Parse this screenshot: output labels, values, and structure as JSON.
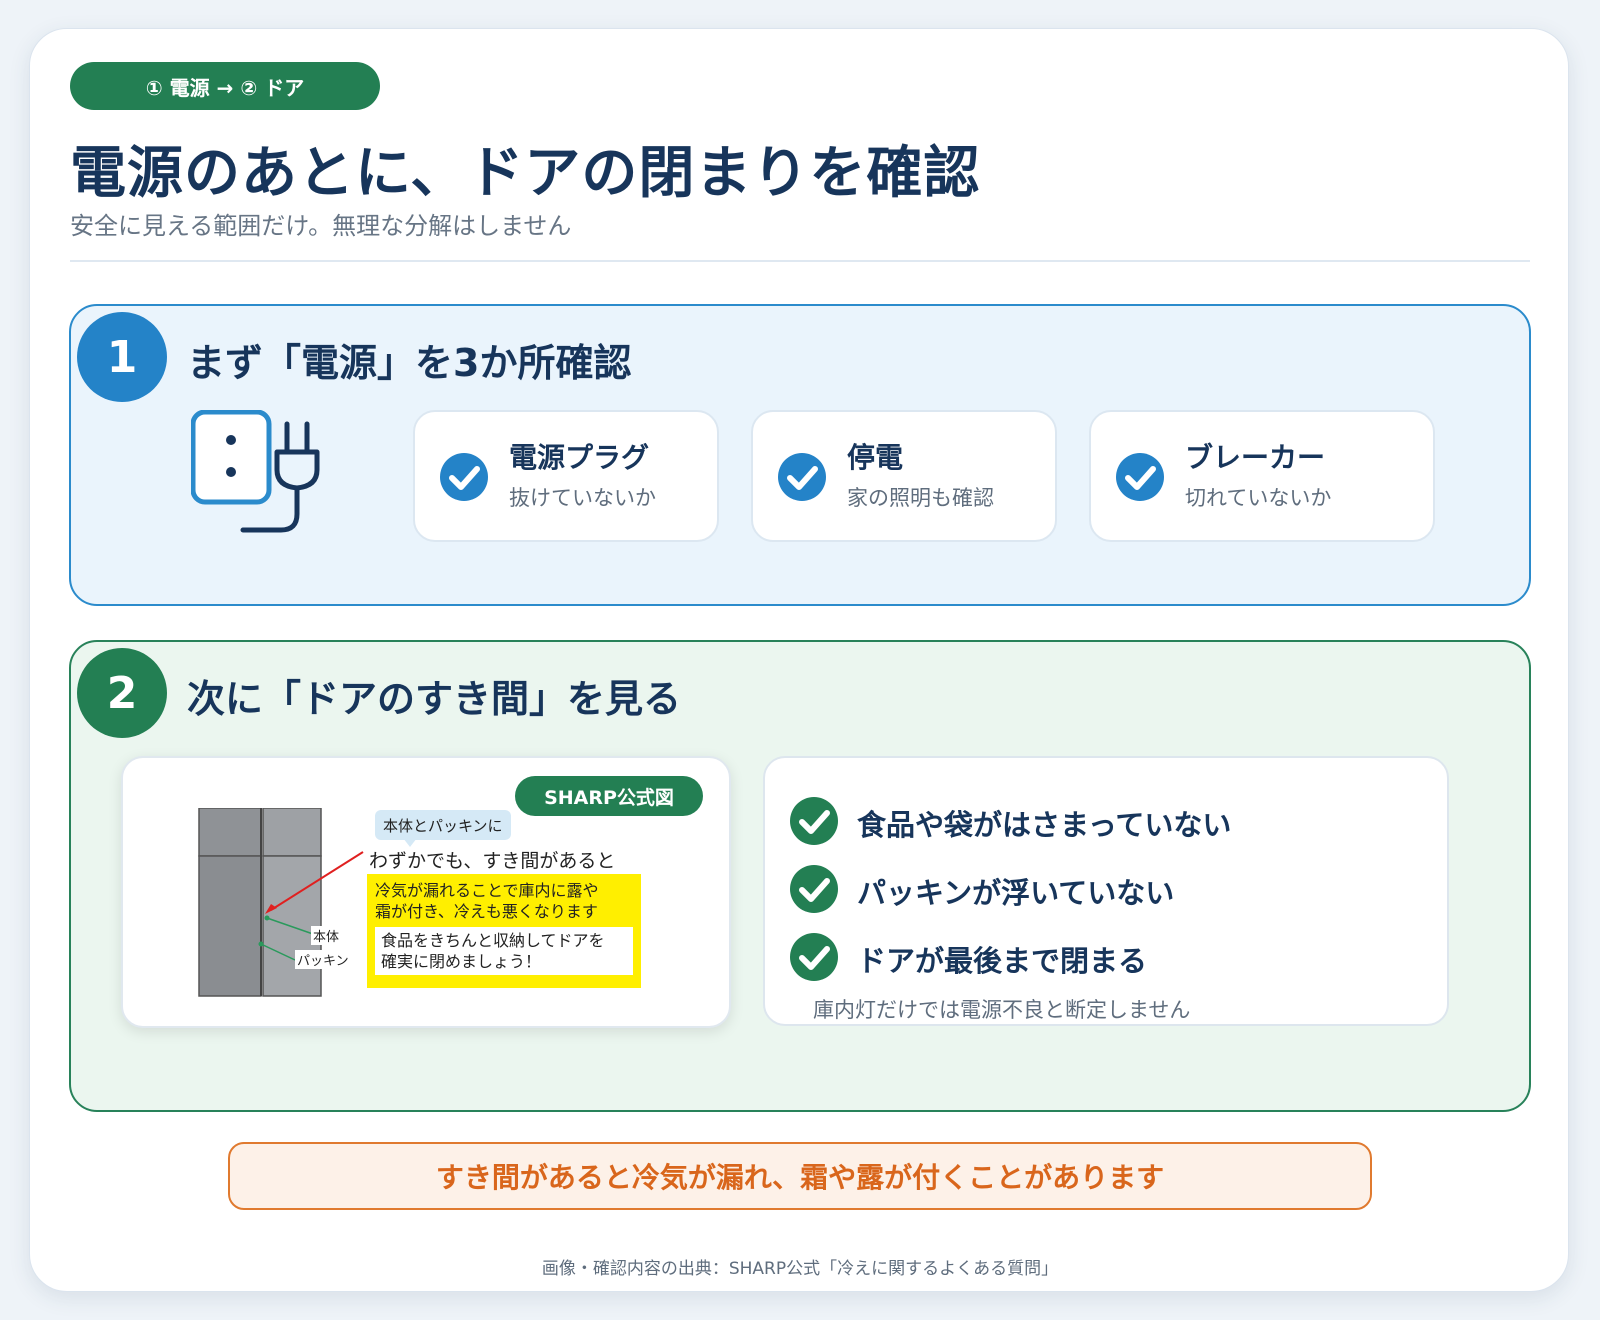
{
  "header": {
    "step_pill": "① 電源 → ② ドア",
    "title": "電源のあとに、ドアの閉まりを確認",
    "subtitle": "安全に見える範囲だけ。無理な分解はしません"
  },
  "section1": {
    "number": "1",
    "title": "まず「電源」を3か所確認",
    "checks": [
      {
        "title": "電源プラグ",
        "sub": "抜けていないか"
      },
      {
        "title": "停電",
        "sub": "家の照明も確認"
      },
      {
        "title": "ブレーカー",
        "sub": "切れていないか"
      }
    ]
  },
  "section2": {
    "number": "2",
    "title": "次に「ドアのすき間」を見る",
    "figure": {
      "badge": "SHARP公式図",
      "bubble": "本体とパッキンに",
      "gap_text": "わずかでも、すき間があると",
      "yellow_line1": "冷気が漏れることで庫内に露や",
      "yellow_line2": "霜が付き、冷えも悪くなります",
      "yellow_inner1": "食品をきちんと収納してドアを",
      "yellow_inner2": "確実に閉めましょう！",
      "label_body": "本体",
      "label_packing": "パッキン"
    },
    "list": [
      "食品や袋がはさまっていない",
      "パッキンが浮いていない",
      "ドアが最後まで閉まる"
    ],
    "note": "庫内灯だけでは電源不良と断定しません"
  },
  "warning": "すき間があると冷気が漏れ、霜や露が付くことがあります",
  "source": "画像・確認内容の出典：SHARP公式「冷えに関するよくある質問」",
  "colors": {
    "navy": "#17355b",
    "blue": "#2483c8",
    "green": "#237f53",
    "orange": "#d9661c",
    "yellow": "#ffef00"
  },
  "icons": [
    "outlet-plug-icon",
    "check-circle-icon",
    "fridge-illustration"
  ]
}
